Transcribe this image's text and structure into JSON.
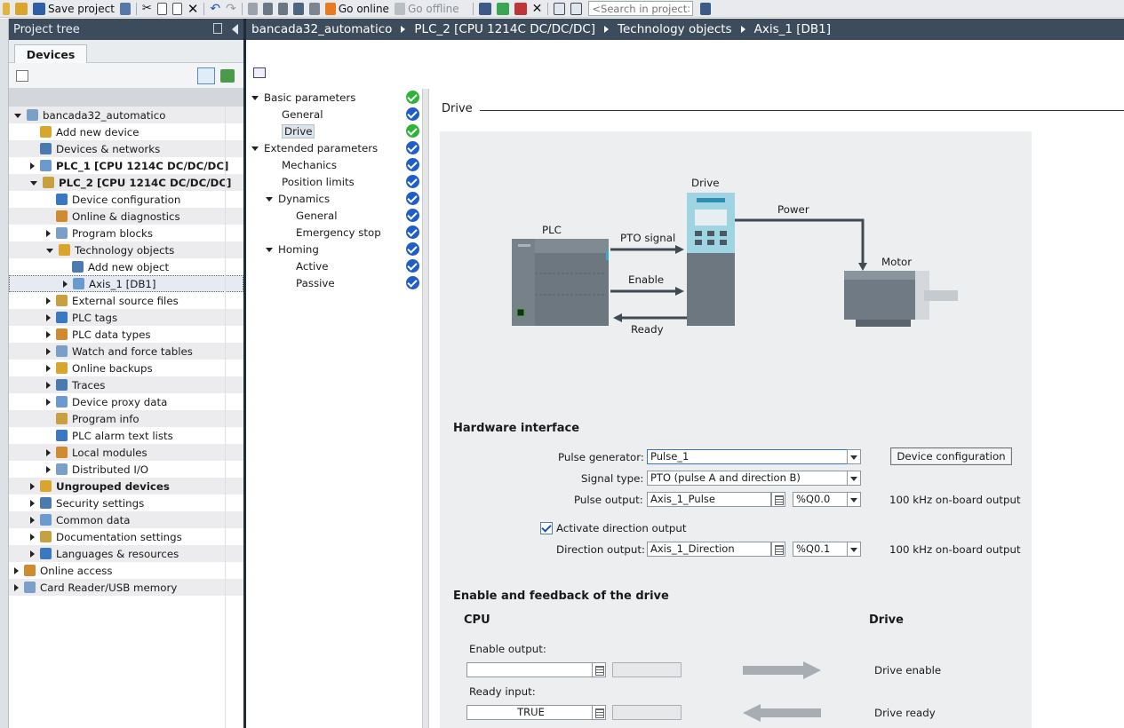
{
  "toolbar": {
    "save_project": "Save project",
    "go_online": "Go online",
    "go_offline": "Go offline",
    "search_placeholder": "<Search in project>"
  },
  "project_tree": {
    "title": "Project tree",
    "tab": "Devices",
    "items": [
      {
        "label": "bancada32_automatico",
        "level": 0,
        "expander": "down",
        "bold": false
      },
      {
        "label": "Add new device",
        "level": 1,
        "expander": "none",
        "bold": false
      },
      {
        "label": "Devices & networks",
        "level": 1,
        "expander": "none",
        "bold": false
      },
      {
        "label": "PLC_1 [CPU 1214C DC/DC/DC]",
        "level": 1,
        "expander": "right",
        "bold": true
      },
      {
        "label": "PLC_2 [CPU 1214C DC/DC/DC]",
        "level": 1,
        "expander": "down",
        "bold": true
      },
      {
        "label": "Device configuration",
        "level": 2,
        "expander": "none",
        "bold": false
      },
      {
        "label": "Online & diagnostics",
        "level": 2,
        "expander": "none",
        "bold": false
      },
      {
        "label": "Program blocks",
        "level": 2,
        "expander": "right",
        "bold": false
      },
      {
        "label": "Technology objects",
        "level": 2,
        "expander": "down",
        "bold": false
      },
      {
        "label": "Add new object",
        "level": 3,
        "expander": "none",
        "bold": false
      },
      {
        "label": "Axis_1 [DB1]",
        "level": 3,
        "expander": "right",
        "bold": false,
        "selected": true
      },
      {
        "label": "External source files",
        "level": 2,
        "expander": "right",
        "bold": false
      },
      {
        "label": "PLC tags",
        "level": 2,
        "expander": "right",
        "bold": false
      },
      {
        "label": "PLC data types",
        "level": 2,
        "expander": "right",
        "bold": false
      },
      {
        "label": "Watch and force tables",
        "level": 2,
        "expander": "right",
        "bold": false
      },
      {
        "label": "Online backups",
        "level": 2,
        "expander": "right",
        "bold": false
      },
      {
        "label": "Traces",
        "level": 2,
        "expander": "right",
        "bold": false
      },
      {
        "label": "Device proxy data",
        "level": 2,
        "expander": "right",
        "bold": false
      },
      {
        "label": "Program info",
        "level": 2,
        "expander": "none",
        "bold": false
      },
      {
        "label": "PLC alarm text lists",
        "level": 2,
        "expander": "none",
        "bold": false
      },
      {
        "label": "Local modules",
        "level": 2,
        "expander": "right",
        "bold": false
      },
      {
        "label": "Distributed I/O",
        "level": 2,
        "expander": "right",
        "bold": false
      },
      {
        "label": "Ungrouped devices",
        "level": 1,
        "expander": "right",
        "bold": true
      },
      {
        "label": "Security settings",
        "level": 1,
        "expander": "right",
        "bold": false
      },
      {
        "label": "Common data",
        "level": 1,
        "expander": "right",
        "bold": false
      },
      {
        "label": "Documentation settings",
        "level": 1,
        "expander": "right",
        "bold": false
      },
      {
        "label": "Languages & resources",
        "level": 1,
        "expander": "right",
        "bold": false
      },
      {
        "label": "Online access",
        "level": 0,
        "expander": "right",
        "bold": false
      },
      {
        "label": "Card Reader/USB memory",
        "level": 0,
        "expander": "right",
        "bold": false
      }
    ]
  },
  "breadcrumb": [
    "bancada32_automatico",
    "PLC_2 [CPU 1214C DC/DC/DC]",
    "Technology objects",
    "Axis_1 [DB1]"
  ],
  "nav": {
    "items": [
      {
        "label": "Basic parameters",
        "level": 0,
        "expander": "down",
        "status": "green"
      },
      {
        "label": "General",
        "level": 1,
        "expander": "none",
        "status": "blue"
      },
      {
        "label": "Drive",
        "level": 1,
        "expander": "none",
        "status": "green",
        "selected": true
      },
      {
        "label": "Extended parameters",
        "level": 0,
        "expander": "down",
        "status": "blue"
      },
      {
        "label": "Mechanics",
        "level": 1,
        "expander": "none",
        "status": "blue"
      },
      {
        "label": "Position limits",
        "level": 1,
        "expander": "none",
        "status": "blue"
      },
      {
        "label": "Dynamics",
        "level": 1,
        "expander": "down",
        "status": "blue"
      },
      {
        "label": "General",
        "level": 2,
        "expander": "none",
        "status": "blue"
      },
      {
        "label": "Emergency stop",
        "level": 2,
        "expander": "none",
        "status": "blue"
      },
      {
        "label": "Homing",
        "level": 1,
        "expander": "down",
        "status": "blue"
      },
      {
        "label": "Active",
        "level": 2,
        "expander": "none",
        "status": "blue"
      },
      {
        "label": "Passive",
        "level": 2,
        "expander": "none",
        "status": "blue"
      }
    ]
  },
  "section_title": "Drive",
  "diagram": {
    "drive_label": "Drive",
    "plc_label": "PLC",
    "power_label": "Power",
    "motor_label": "Motor",
    "pto_label": "PTO signal",
    "enable_label": "Enable",
    "ready_label": "Ready"
  },
  "hardware_interface": {
    "title": "Hardware interface",
    "pulse_generator_label": "Pulse generator:",
    "pulse_generator_value": "Pulse_1",
    "device_config_button": "Device configuration",
    "signal_type_label": "Signal type:",
    "signal_type_value": "PTO (pulse A and direction B)",
    "pulse_output_label": "Pulse output:",
    "pulse_output_value": "Axis_1_Pulse",
    "pulse_output_address": "%Q0.0",
    "pulse_output_info": "100 kHz on-board output",
    "activate_direction_label": "Activate direction output",
    "activate_direction_checked": true,
    "direction_output_label": "Direction output:",
    "direction_output_value": "Axis_1_Direction",
    "direction_output_address": "%Q0.1",
    "direction_output_info": "100 kHz on-board output"
  },
  "enable_feedback": {
    "title": "Enable and feedback of the drive",
    "cpu_heading": "CPU",
    "drive_heading": "Drive",
    "enable_output_label": "Enable output:",
    "enable_output_value": "",
    "drive_enable_label": "Drive enable",
    "ready_input_label": "Ready input:",
    "ready_input_value": "TRUE",
    "drive_ready_label": "Drive ready"
  },
  "colors": {
    "header_bg": "#3c4c5c",
    "status_green": "#2db336",
    "status_blue": "#1f5ec8",
    "panel_bg": "#eceeef"
  }
}
